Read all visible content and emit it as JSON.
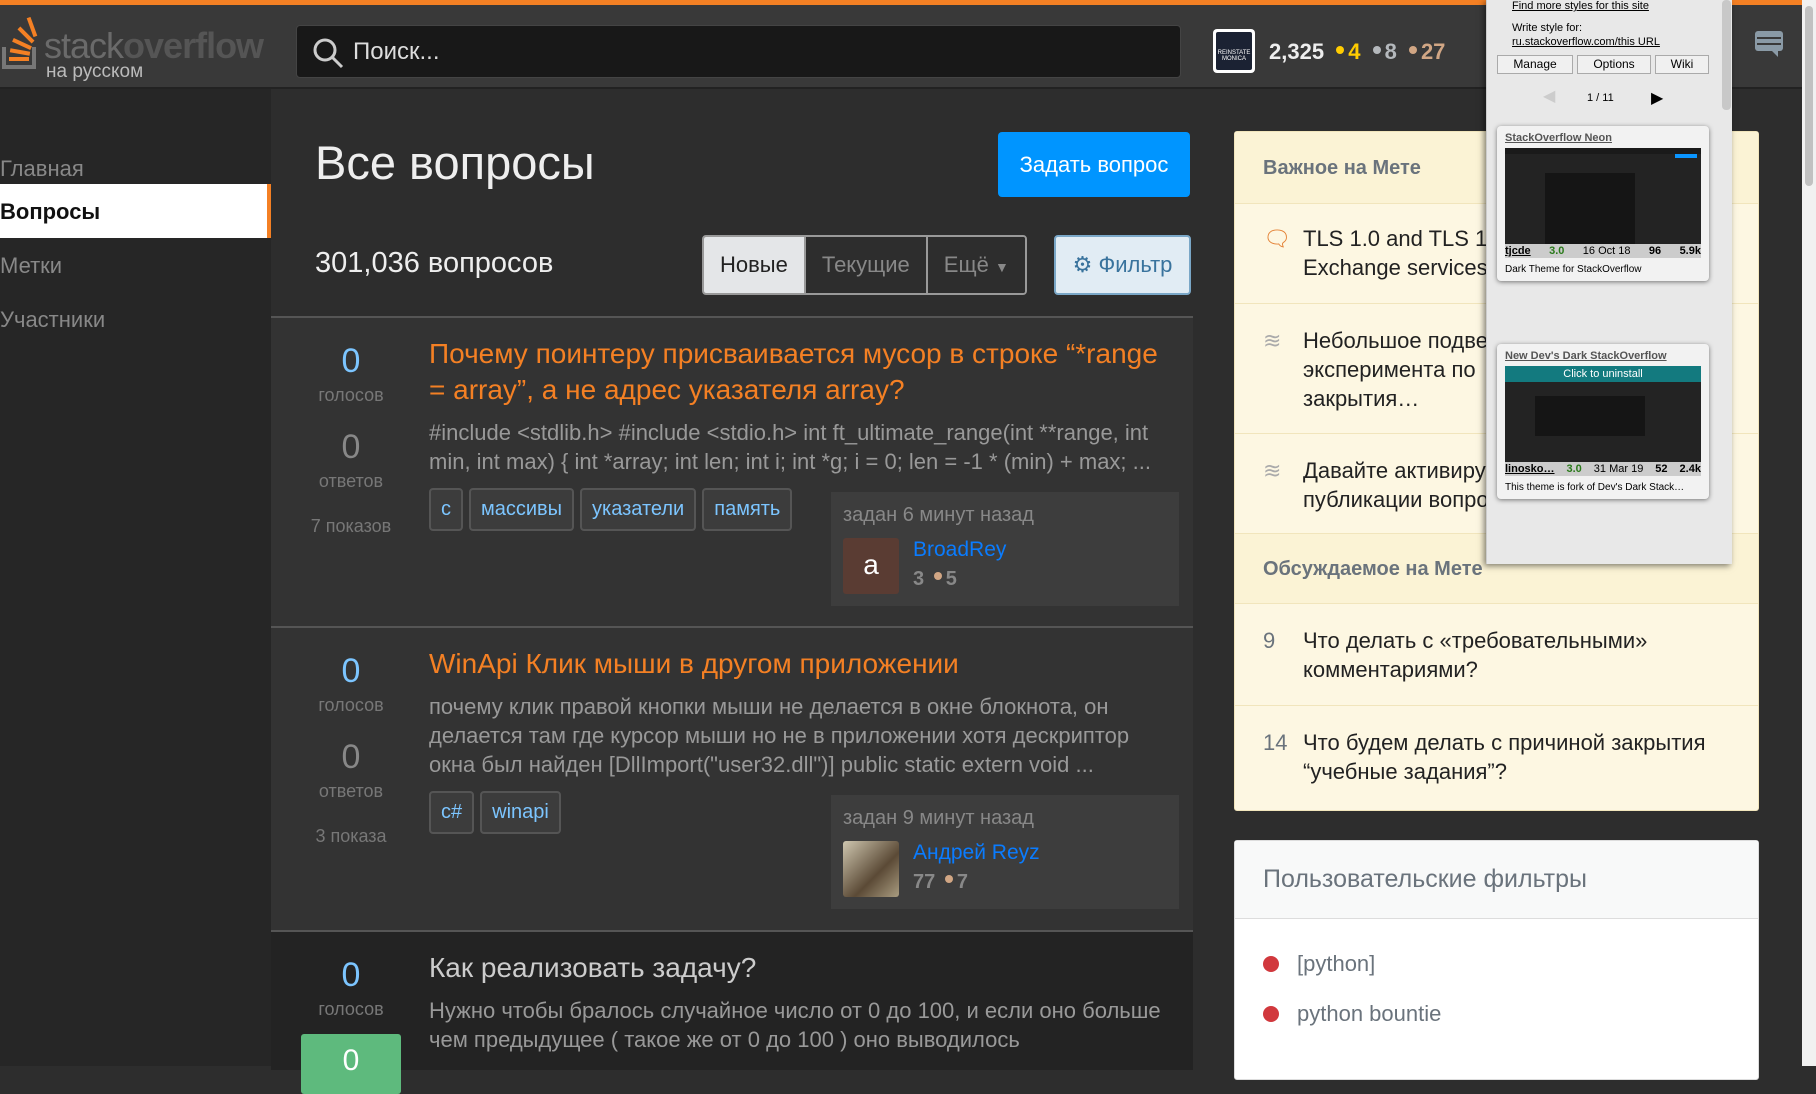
{
  "header": {
    "logo_word1": "stack",
    "logo_word2": "overflow",
    "logo_sub": "на русском",
    "search_placeholder": "Поиск...",
    "reputation": "2,325",
    "gold": "4",
    "silver": "8",
    "bronze": "27",
    "avatar_text": "REINSTATE MONICA"
  },
  "nav": {
    "items": [
      {
        "label": "Главная"
      },
      {
        "label": "Вопросы"
      },
      {
        "label": "Метки"
      },
      {
        "label": "Участники"
      }
    ]
  },
  "main": {
    "title": "Все вопросы",
    "ask_label": "Задать вопрос",
    "count": "301,036 вопросов",
    "sorts": [
      {
        "label": "Новые"
      },
      {
        "label": "Текущие"
      },
      {
        "label": "Ещё"
      }
    ],
    "filter_label": "Фильтр",
    "questions": [
      {
        "votes": "0",
        "votes_label": "голосов",
        "answers": "0",
        "answers_label": "ответов",
        "views": "7 показов",
        "title": "Почему поинтеру присваивается мусор в строке “*range = array”, а не адрес указателя array?",
        "excerpt": "#include <stdlib.h> #include <stdio.h> int ft_ultimate_range(int **range, int min, int max) { int *array; int len; int i; int *g; i = 0; len = -1 * (min) + max; ...",
        "tags": [
          "c",
          "массивы",
          "указатели",
          "память"
        ],
        "asked": "задан 6 минут назад",
        "user": "BroadRey",
        "avatar_letter": "a",
        "rep": "3",
        "bronze": "5"
      },
      {
        "votes": "0",
        "votes_label": "голосов",
        "answers": "0",
        "answers_label": "ответов",
        "views": "3 показа",
        "title": "WinApi Клик мыши в другом приложении",
        "excerpt": "почему клик правой кнопки мыши не делается в окне блокнота, он делается там где курсор мыши но не в приложении хотя дескриптор окна был найден [DllImport(\"user32.dll\")] public static extern void ...",
        "tags": [
          "c#",
          "winapi"
        ],
        "asked": "задан 9 минут назад",
        "user": "Андрей Reyz",
        "rep": "77",
        "bronze": "7"
      },
      {
        "votes": "0",
        "votes_label": "голосов",
        "answers": "0",
        "title": "Как реализовать задачу?",
        "excerpt": "Нужно чтобы бралось случайное число от 0 до 100, и если оно больше чем предыдущее ( такое же от 0 до 100 ) оно выводилось"
      }
    ]
  },
  "meta": {
    "featured_title": "Важное на Мете",
    "featured": [
      {
        "title": "TLS 1.0 and TLS 1.1 ... Exchange services",
        "line1": "TLS 1.0 and TLS 1",
        "line2": "Exchange services"
      },
      {
        "line1": "Небольшое подве",
        "line2": "эксперимента по",
        "line3": "закрытия…"
      },
      {
        "line1": "Давайте активиру",
        "line2": "публикации вопро"
      }
    ],
    "hot_title": "Обсуждаемое на Мете",
    "hot": [
      {
        "count": "9",
        "line1": "Что делать с «требовательными»",
        "line2": "комментариями?"
      },
      {
        "count": "14",
        "line1": "Что будем делать с причиной закрытия",
        "line2": "“учебные задания”?"
      }
    ]
  },
  "filters": {
    "title": "Пользовательские фильтры",
    "items": [
      "[python]",
      "python bountie"
    ]
  },
  "stylus_popup": {
    "find_more": "Find more styles for this site",
    "write_for": "Write style for:",
    "write_url": "ru.stackoverflow.com/this URL",
    "buttons": [
      "Manage",
      "Options",
      "Wiki"
    ],
    "page": "1 / 11",
    "styles": [
      {
        "name": "StackOverflow Neon",
        "author": "tjcde",
        "rating": "3.0",
        "date": "16 Oct 18",
        "installs": "96",
        "views": "5.9k",
        "desc": "Dark Theme for StackOverflow"
      },
      {
        "name": "New Dev's Dark StackOverflow",
        "overlay": "Click to uninstall",
        "author": "linosko…",
        "rating": "3.0",
        "date": "31 Mar 19",
        "installs": "52",
        "views": "2.4k",
        "desc": "This theme is fork of Dev's Dark Stack…"
      }
    ]
  },
  "colors": {
    "accent": "#f48024",
    "ask": "#0095ff",
    "link": "#7cc5ff"
  }
}
